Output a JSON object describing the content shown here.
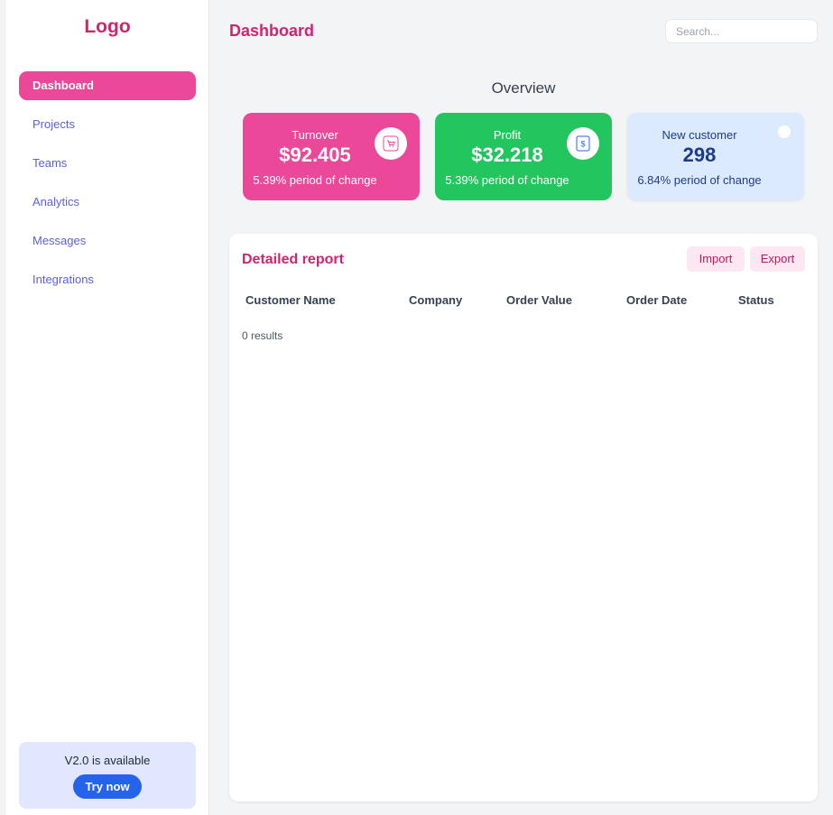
{
  "sidebar": {
    "logo": "Logo",
    "items": [
      {
        "label": "Dashboard"
      },
      {
        "label": "Projects"
      },
      {
        "label": "Teams"
      },
      {
        "label": "Analytics"
      },
      {
        "label": "Messages"
      },
      {
        "label": "Integrations"
      }
    ],
    "promo": {
      "text": "V2.0 is available",
      "button": "Try now"
    }
  },
  "header": {
    "title": "Dashboard",
    "search_placeholder": "Search..."
  },
  "overview": {
    "title": "Overview",
    "cards": [
      {
        "label": "Turnover",
        "value": "$92.405",
        "change": "5.39% period of change",
        "icon": "cart-icon"
      },
      {
        "label": "Profit",
        "value": "$32.218",
        "change": "5.39% period of change",
        "icon": "dollar-icon"
      },
      {
        "label": "New customer",
        "value": "298",
        "change": "6.84% period of change",
        "icon": "circle-icon"
      }
    ]
  },
  "report": {
    "title": "Detailed report",
    "import_label": "Import",
    "export_label": "Export",
    "columns": [
      "Customer Name",
      "Company",
      "Order Value",
      "Order Date",
      "Status"
    ],
    "results_text": "0 results"
  },
  "colors": {
    "accent": "#d0246f",
    "pink_card": "#ec4899",
    "green_card": "#22c55e",
    "blue_card": "#dbeafe",
    "nav_text": "#5b5fe0",
    "try_button": "#2563eb"
  }
}
